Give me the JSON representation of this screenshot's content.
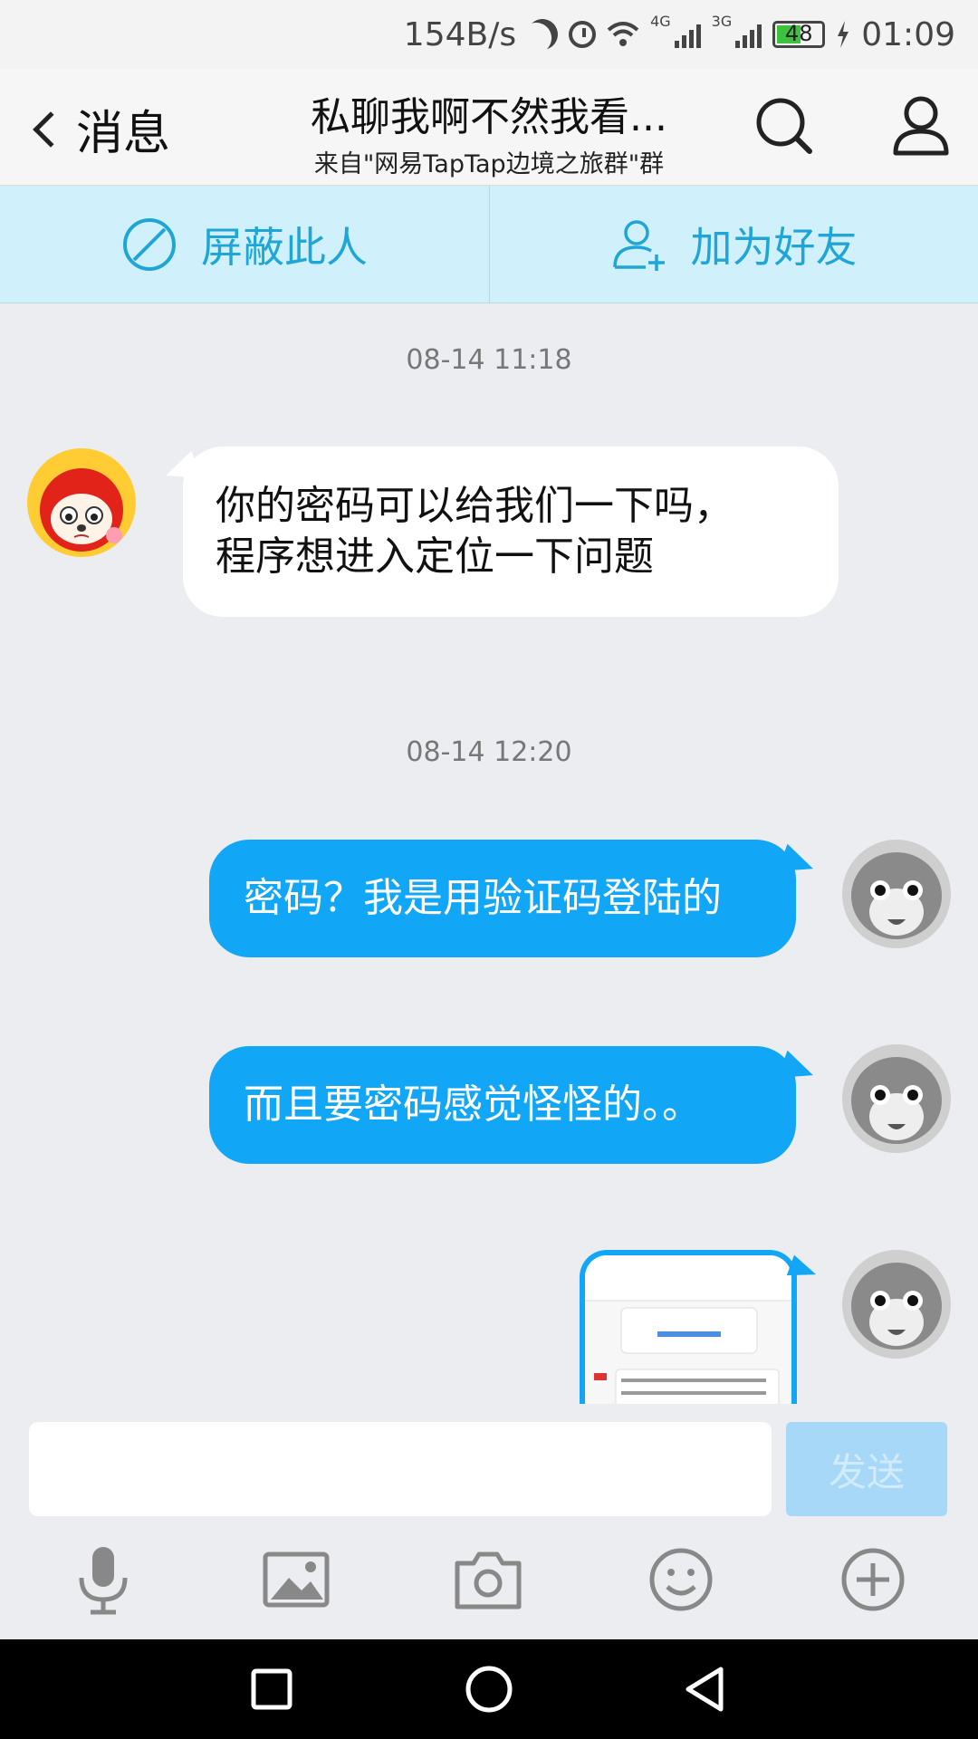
{
  "status_bar": {
    "net_speed": "154B/s",
    "sim1_tag": "4G",
    "sim2_tag": "3G",
    "battery": "48",
    "time": "01:09"
  },
  "header": {
    "back_label": "消息",
    "title": "私聊我啊不然我看...",
    "subtitle": "来自\"网易TapTap边境之旅群\"群",
    "icons": [
      "search-icon",
      "profile-icon"
    ]
  },
  "actions": {
    "block_label": "屏蔽此人",
    "add_friend_label": "加为好友"
  },
  "messages": [
    {
      "timestamp": "08-14 11:18"
    },
    {
      "from": "other",
      "lines": [
        "你的密码可以给我们一下吗，",
        "程序想进入定位一下问题"
      ]
    },
    {
      "timestamp": "08-14 12:20"
    },
    {
      "from": "me",
      "text": "密码？我是用验证码登陆的"
    },
    {
      "from": "me",
      "text": "而且要密码感觉怪怪的。。"
    },
    {
      "from": "me",
      "type": "image"
    }
  ],
  "input": {
    "value": "",
    "send_label": "发送"
  },
  "toolbar_icons": [
    "microphone-icon",
    "image-icon",
    "camera-icon",
    "emoji-icon",
    "plus-icon"
  ],
  "colors": {
    "accent": "#12a6f6",
    "action_bar_bg": "#d0f0fb",
    "action_text": "#20a6d6",
    "chat_bg": "#ebedf0"
  }
}
